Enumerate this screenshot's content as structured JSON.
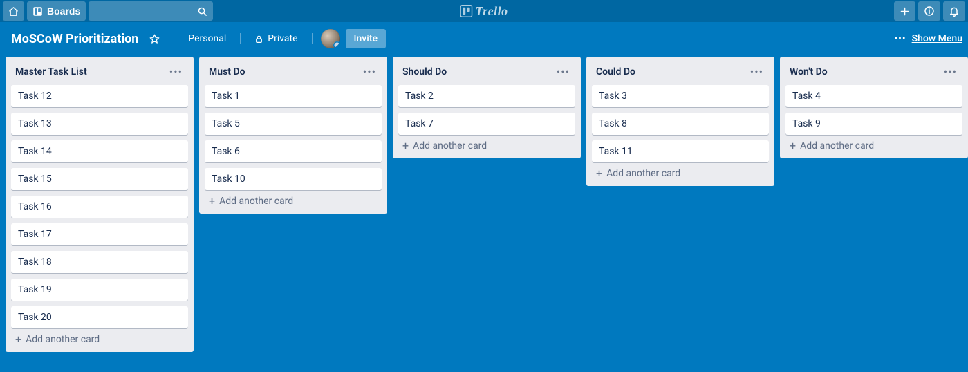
{
  "app": {
    "name": "Trello"
  },
  "nav": {
    "boards_label": "Boards",
    "search_placeholder": ""
  },
  "board": {
    "name": "MoSCoW Prioritization",
    "team_label": "Personal",
    "visibility_label": "Private",
    "invite_label": "Invite",
    "show_menu_label": "Show Menu"
  },
  "addCardLabel": "Add another card",
  "lists": [
    {
      "title": "Master Task List",
      "cards": [
        "Task 12",
        "Task 13",
        "Task 14",
        "Task 15",
        "Task 16",
        "Task 17",
        "Task 18",
        "Task 19",
        "Task 20"
      ]
    },
    {
      "title": "Must Do",
      "cards": [
        "Task 1",
        "Task 5",
        "Task 6",
        "Task 10"
      ]
    },
    {
      "title": "Should Do",
      "cards": [
        "Task 2",
        "Task 7"
      ]
    },
    {
      "title": "Could Do",
      "cards": [
        "Task 3",
        "Task 8",
        "Task 11"
      ]
    },
    {
      "title": "Won't Do",
      "cards": [
        "Task 4",
        "Task 9"
      ]
    }
  ]
}
